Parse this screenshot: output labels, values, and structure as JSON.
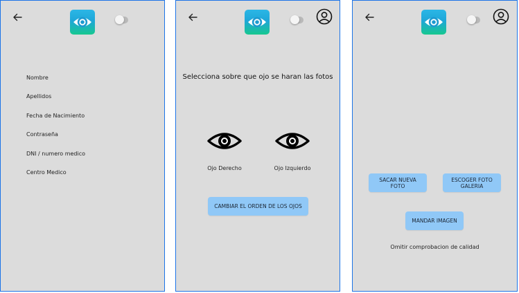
{
  "colors": {
    "screen_background": "#dcdcdc",
    "screen_border": "#1a73e8",
    "button_background": "#90c8f7",
    "logo_gradient_top": "#2bb6e6",
    "logo_gradient_bottom": "#17c88f"
  },
  "icons": {
    "back": "arrow-left-icon",
    "logo": "eye-logo-icon",
    "account": "account-circle-icon",
    "eye": "eye-icon"
  },
  "screen1": {
    "fields": [
      {
        "label": "Nombre"
      },
      {
        "label": "Apellidos"
      },
      {
        "label": "Fecha de Nacimiento"
      },
      {
        "label": "Contraseña"
      },
      {
        "label": "DNI / numero medico"
      },
      {
        "label": "Centro Medico"
      }
    ]
  },
  "screen2": {
    "heading": "Selecciona sobre que ojo se haran las fotos",
    "right_eye_label": "Ojo Derecho",
    "left_eye_label": "Ojo Izquierdo",
    "swap_button": "CAMBIAR EL ORDEN DE LOS OJOS"
  },
  "screen3": {
    "take_photo_button": "SACAR NUEVA FOTO",
    "gallery_button_line1": "ESCOGER FOTO",
    "gallery_button_line2": "GALERIA",
    "send_button": "MANDAR IMAGEN",
    "skip_quality_link": "Omitir comprobacion de calidad"
  }
}
